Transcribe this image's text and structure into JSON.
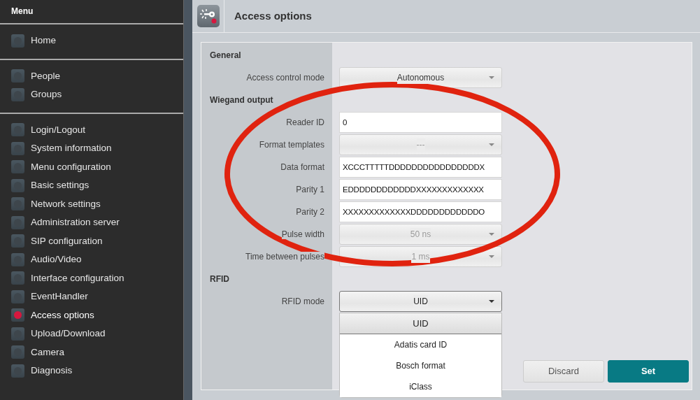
{
  "sidebar": {
    "title": "Menu",
    "groups": [
      {
        "items": [
          {
            "label": "Home",
            "selected": false
          }
        ]
      },
      {
        "items": [
          {
            "label": "People",
            "selected": false
          },
          {
            "label": "Groups",
            "selected": false
          }
        ]
      },
      {
        "items": [
          {
            "label": "Login/Logout",
            "selected": false
          },
          {
            "label": "System information",
            "selected": false
          },
          {
            "label": "Menu configuration",
            "selected": false
          },
          {
            "label": "Basic settings",
            "selected": false
          },
          {
            "label": "Network settings",
            "selected": false
          },
          {
            "label": "Administration server",
            "selected": false
          },
          {
            "label": "SIP configuration",
            "selected": false
          },
          {
            "label": "Audio/Video",
            "selected": false
          },
          {
            "label": "Interface configuration",
            "selected": false
          },
          {
            "label": "EventHandler",
            "selected": false
          },
          {
            "label": "Access options",
            "selected": true
          },
          {
            "label": "Upload/Download",
            "selected": false
          },
          {
            "label": "Camera",
            "selected": false
          },
          {
            "label": "Diagnosis",
            "selected": false
          }
        ]
      }
    ]
  },
  "header": {
    "title": "Access options"
  },
  "form": {
    "rows": [
      {
        "kind": "heading",
        "label": "General"
      },
      {
        "kind": "select",
        "label": "Access control mode",
        "value": "Autonomous",
        "disabled": false,
        "open": false
      },
      {
        "kind": "heading",
        "label": "Wiegand output"
      },
      {
        "kind": "input",
        "label": "Reader ID",
        "value": "0"
      },
      {
        "kind": "select",
        "label": "Format templates",
        "value": "---",
        "disabled": true,
        "open": false
      },
      {
        "kind": "input",
        "label": "Data format",
        "value": "XCCCTTTTTDDDDDDDDDDDDDDDDX"
      },
      {
        "kind": "input",
        "label": "Parity 1",
        "value": "EDDDDDDDDDDDDXXXXXXXXXXXXX"
      },
      {
        "kind": "input",
        "label": "Parity 2",
        "value": "XXXXXXXXXXXXXDDDDDDDDDDDDO"
      },
      {
        "kind": "select",
        "label": "Pulse width",
        "value": "50 ns",
        "disabled": true,
        "open": false
      },
      {
        "kind": "select",
        "label": "Time between pulses",
        "value": "1 ms",
        "disabled": true,
        "open": false
      },
      {
        "kind": "heading",
        "label": "RFID"
      },
      {
        "kind": "select",
        "label": "RFID mode",
        "value": "UID",
        "disabled": false,
        "open": true,
        "options": [
          {
            "label": "UID",
            "selected": true
          },
          {
            "label": "Adatis card ID",
            "selected": false
          },
          {
            "label": "Bosch format",
            "selected": false
          },
          {
            "label": "iClass",
            "selected": false
          }
        ]
      }
    ]
  },
  "buttons": [
    {
      "label": "Discard",
      "kind": "secondary"
    },
    {
      "label": "Set",
      "kind": "primary"
    }
  ],
  "annotations": [
    {
      "kind": "ellipse",
      "color": "#e0230f"
    }
  ]
}
